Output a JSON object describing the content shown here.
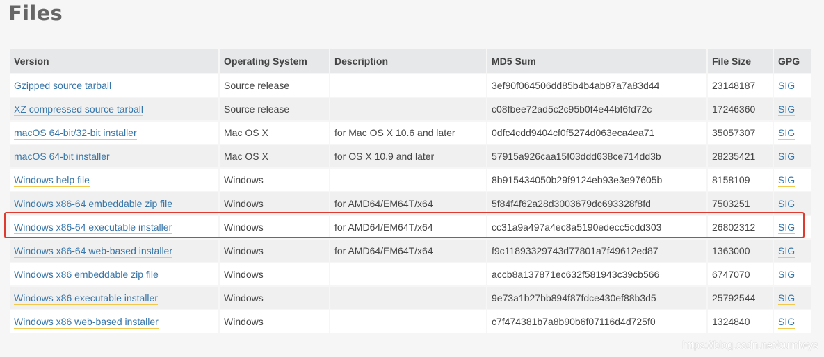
{
  "page": {
    "title": "Files"
  },
  "table": {
    "headers": [
      "Version",
      "Operating System",
      "Description",
      "MD5 Sum",
      "File Size",
      "GPG"
    ],
    "rows": [
      {
        "version": "Gzipped source tarball",
        "os": "Source release",
        "description": "",
        "md5": "3ef90f064506dd85b4b4ab87a7a83d44",
        "size": "23148187",
        "gpg": "SIG"
      },
      {
        "version": "XZ compressed source tarball",
        "os": "Source release",
        "description": "",
        "md5": "c08fbee72ad5c2c95b0f4e44bf6fd72c",
        "size": "17246360",
        "gpg": "SIG"
      },
      {
        "version": "macOS 64-bit/32-bit installer",
        "os": "Mac OS X",
        "description": "for Mac OS X 10.6 and later",
        "md5": "0dfc4cdd9404cf0f5274d063eca4ea71",
        "size": "35057307",
        "gpg": "SIG"
      },
      {
        "version": "macOS 64-bit installer",
        "os": "Mac OS X",
        "description": "for OS X 10.9 and later",
        "md5": "57915a926caa15f03ddd638ce714dd3b",
        "size": "28235421",
        "gpg": "SIG"
      },
      {
        "version": "Windows help file",
        "os": "Windows",
        "description": "",
        "md5": "8b915434050b29f9124eb93e3e97605b",
        "size": "8158109",
        "gpg": "SIG"
      },
      {
        "version": "Windows x86-64 embeddable zip file",
        "os": "Windows",
        "description": "for AMD64/EM64T/x64",
        "md5": "5f84f4f62a28d3003679dc693328f8fd",
        "size": "7503251",
        "gpg": "SIG"
      },
      {
        "version": "Windows x86-64 executable installer",
        "os": "Windows",
        "description": "for AMD64/EM64T/x64",
        "md5": "cc31a9a497a4ec8a5190edecc5cdd303",
        "size": "26802312",
        "gpg": "SIG"
      },
      {
        "version": "Windows x86-64 web-based installer",
        "os": "Windows",
        "description": "for AMD64/EM64T/x64",
        "md5": "f9c11893329743d77801a7f49612ed87",
        "size": "1363000",
        "gpg": "SIG"
      },
      {
        "version": "Windows x86 embeddable zip file",
        "os": "Windows",
        "description": "",
        "md5": "accb8a137871ec632f581943c39cb566",
        "size": "6747070",
        "gpg": "SIG"
      },
      {
        "version": "Windows x86 executable installer",
        "os": "Windows",
        "description": "",
        "md5": "9e73a1b27bb894f87fdce430ef88b3d5",
        "size": "25792544",
        "gpg": "SIG"
      },
      {
        "version": "Windows x86 web-based installer",
        "os": "Windows",
        "description": "",
        "md5": "c7f474381b7a8b90b6f07116d4d725f0",
        "size": "1324840",
        "gpg": "SIG"
      }
    ]
  },
  "watermark": "https://blog.csdn.net/cumlwys",
  "colors": {
    "link": "#3675a9",
    "link_underline": "#f2c94c",
    "highlight_border": "#e03a30",
    "header_bg": "#e6e8ea"
  }
}
